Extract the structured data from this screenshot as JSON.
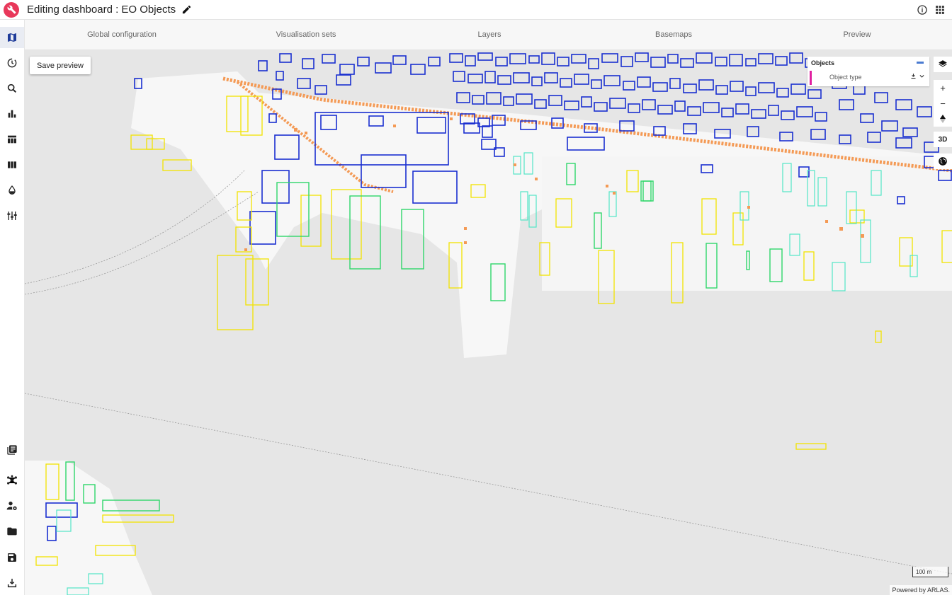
{
  "header": {
    "title": "Editing dashboard : EO Objects"
  },
  "tabs": [
    {
      "label": "Global configuration"
    },
    {
      "label": "Visualisation sets"
    },
    {
      "label": "Layers"
    },
    {
      "label": "Basemaps"
    },
    {
      "label": "Preview"
    }
  ],
  "map": {
    "save_preview_label": "Save preview",
    "legend": {
      "title": "Objects",
      "field": "Object type"
    },
    "control_3d": "3D",
    "scale_label": "100 m",
    "attribution": "Powered by ARLAS."
  },
  "colors": {
    "brand": "#e8385a",
    "blue_objects": "#1a2fd0",
    "yellow_objects": "#f2e300",
    "green_objects": "#2fd66a",
    "cyan_objects": "#52e6c6",
    "orange_buildings": "#f49a55"
  }
}
